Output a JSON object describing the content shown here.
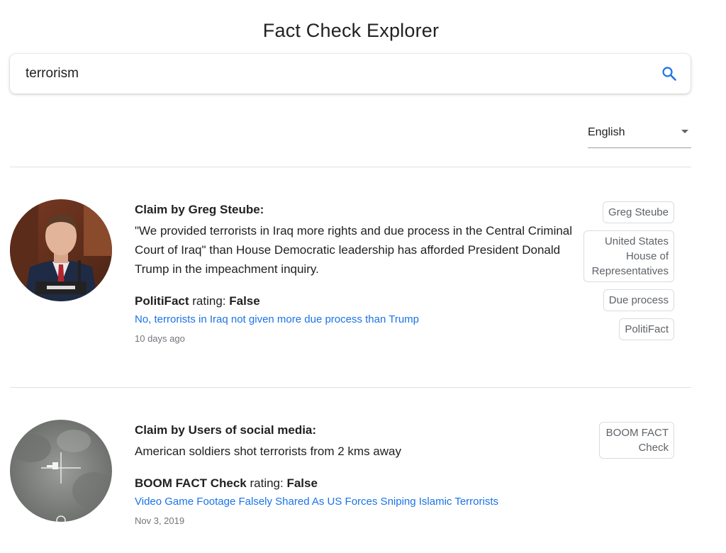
{
  "header": {
    "title": "Fact Check Explorer"
  },
  "search": {
    "value": "terrorism"
  },
  "language": {
    "selected": "English"
  },
  "results": [
    {
      "claim_prefix": "Claim by",
      "claimant": "Greg Steube:",
      "claim_text": "\"We provided terrorists in Iraq more rights and due process in the Central Criminal Court of Iraq\" than House Democratic leadership has afforded President Donald Trump in the impeachment inquiry.",
      "publisher": "PolitiFact",
      "rating_word": "rating:",
      "rating": "False",
      "article_title": "No, terrorists in Iraq not given more due process than Trump",
      "date": "10 days ago",
      "tags": [
        "Greg Steube",
        "United States House of Representatives",
        "Due process",
        "PolitiFact"
      ],
      "thumb_desc": "man speaking at hearing"
    },
    {
      "claim_prefix": "Claim by",
      "claimant": "Users of social media:",
      "claim_text": "American soldiers shot terrorists from 2 kms away",
      "publisher": "BOOM FACT Check",
      "rating_word": "rating:",
      "rating": "False",
      "article_title": "Video Game Footage Falsely Shared As US Forces Sniping Islamic Terrorists",
      "date": "Nov 3, 2019",
      "tags": [
        "BOOM FACT Check"
      ],
      "thumb_desc": "thermal scope footage"
    }
  ],
  "colors": {
    "link": "#1a73e8",
    "accent": "#1a73e8",
    "tag_border": "#dadce0"
  }
}
